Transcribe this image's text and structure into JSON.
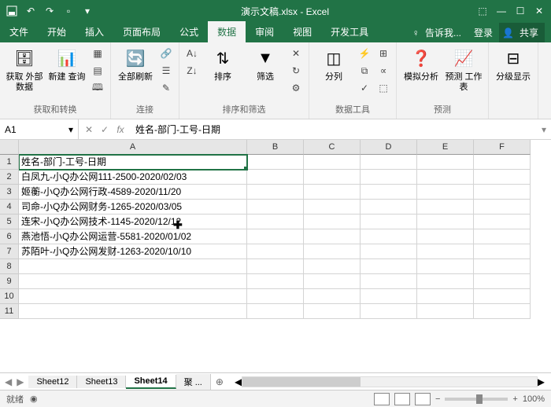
{
  "title": "演示文稿.xlsx - Excel",
  "tabs": [
    "文件",
    "开始",
    "插入",
    "页面布局",
    "公式",
    "数据",
    "审阅",
    "视图",
    "开发工具"
  ],
  "active_tab": "数据",
  "tell_me": "告诉我...",
  "signin": "登录",
  "share": "共享",
  "ribbon": {
    "g1": {
      "btn": "获取\n外部数据",
      "label": "获取和转换"
    },
    "g1b": {
      "btn": "新建\n查询"
    },
    "g2": {
      "btn": "全部刷新",
      "label": "连接"
    },
    "g3": {
      "sort": "排序",
      "filter": "筛选",
      "label": "排序和筛选"
    },
    "g4": {
      "btn": "分列",
      "label": "数据工具"
    },
    "g5": {
      "btn1": "模拟分析",
      "btn2": "预测\n工作表",
      "label": "预测"
    },
    "g6": {
      "btn": "分级显示",
      "label": ""
    }
  },
  "namebox": "A1",
  "formula": "姓名-部门-工号-日期",
  "columns": [
    "A",
    "B",
    "C",
    "D",
    "E",
    "F"
  ],
  "rows": [
    "姓名-部门-工号-日期",
    "白凤九-小Q办公网111-2500-2020/02/03",
    "姬蘅-小Q办公网行政-4589-2020/11/20",
    "司命-小Q办公网财务-1265-2020/03/05",
    "连宋-小Q办公网技术-1145-2020/12/12",
    "燕池悟-小Q办公网运营-5581-2020/01/02",
    "苏陌叶-小Q办公网发财-1263-2020/10/10",
    "",
    "",
    "",
    ""
  ],
  "sheets": [
    "Sheet12",
    "Sheet13",
    "Sheet14"
  ],
  "active_sheet": "Sheet14",
  "sheet_more": "聚 ...",
  "status": "就绪",
  "zoom": "100%"
}
